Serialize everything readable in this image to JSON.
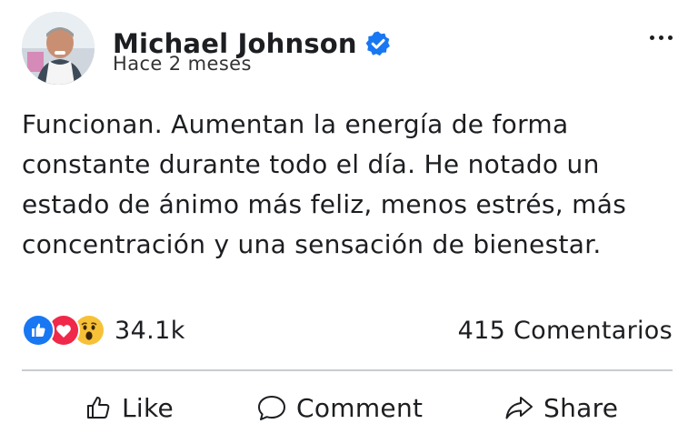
{
  "author": {
    "name": "Michael Johnson",
    "verified": true,
    "time": "Hace 2 meses"
  },
  "post": {
    "text": "Funcionan. Aumentan la energía de forma constante durante todo el día. He notado un estado de ánimo más feliz, menos estrés, más concentración y una sensación de bienestar."
  },
  "stats": {
    "reactions": [
      "like-icon",
      "love-icon",
      "wow-icon"
    ],
    "reaction_count": "34.1k",
    "comments": "415 Comentarios"
  },
  "actions": {
    "like": "Like",
    "comment": "Comment",
    "share": "Share"
  },
  "colors": {
    "verified": "#1877f2",
    "like": "#1877f2",
    "love": "#f0284a",
    "wow": "#f7c137"
  }
}
